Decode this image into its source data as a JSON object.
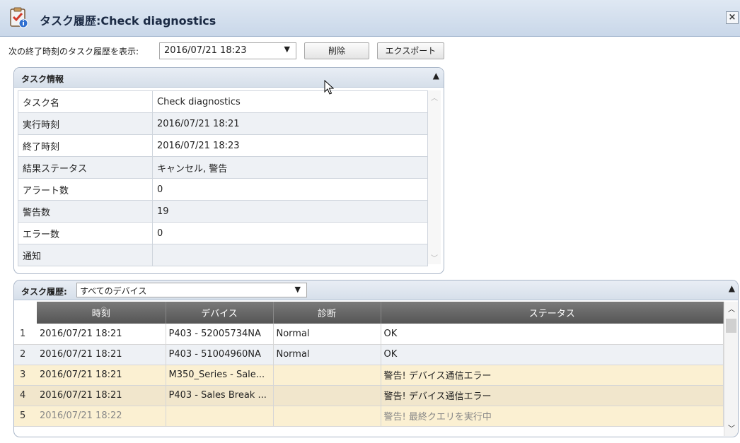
{
  "window": {
    "title": "タスク履歴:Check diagnostics",
    "close": "×"
  },
  "toolbar": {
    "filter_label": "次の終了時刻のタスク履歴を表示:",
    "date_value": "2016/07/21 18:23",
    "delete_label": "削除",
    "export_label": "エクスポート"
  },
  "info": {
    "title": "タスク情報",
    "rows": [
      {
        "key": "タスク名",
        "value": "Check diagnostics"
      },
      {
        "key": "実行時刻",
        "value": "2016/07/21 18:21"
      },
      {
        "key": "終了時刻",
        "value": "2016/07/21 18:23"
      },
      {
        "key": "結果ステータス",
        "value": "キャンセル, 警告"
      },
      {
        "key": "アラート数",
        "value": "0"
      },
      {
        "key": "警告数",
        "value": "19"
      },
      {
        "key": "エラー数",
        "value": "0"
      },
      {
        "key": "通知",
        "value": ""
      }
    ]
  },
  "history": {
    "label": "タスク履歴:",
    "device_filter": "すべてのデバイス",
    "columns": [
      "時刻",
      "デバイス",
      "診断",
      "ステータス"
    ],
    "rows": [
      {
        "n": "1",
        "time": "2016/07/21 18:21",
        "device": "P403 - 52005734NA",
        "diag": "Normal",
        "status": "OK"
      },
      {
        "n": "2",
        "time": "2016/07/21 18:21",
        "device": "P403 - 51004960NA",
        "diag": "Normal",
        "status": "OK"
      },
      {
        "n": "3",
        "time": "2016/07/21 18:21",
        "device": "M350_Series - Sale...",
        "diag": "",
        "status": "警告! デバイス通信エラー"
      },
      {
        "n": "4",
        "time": "2016/07/21 18:21",
        "device": "P403 - Sales Break ...",
        "diag": "",
        "status": "警告! デバイス通信エラー"
      },
      {
        "n": "5",
        "time": "2016/07/21 18:22",
        "device": "",
        "diag": "",
        "status": "警告! 最終クエリを実行中"
      }
    ]
  },
  "colors": {
    "titlebar": "#c9d7e9",
    "header": "#5e5e5e",
    "warn_row": "#fbf0d2"
  },
  "icons": {
    "app": "clipboard-check-info-icon",
    "close": "close-icon",
    "cursor": "mouse-pointer-icon"
  }
}
